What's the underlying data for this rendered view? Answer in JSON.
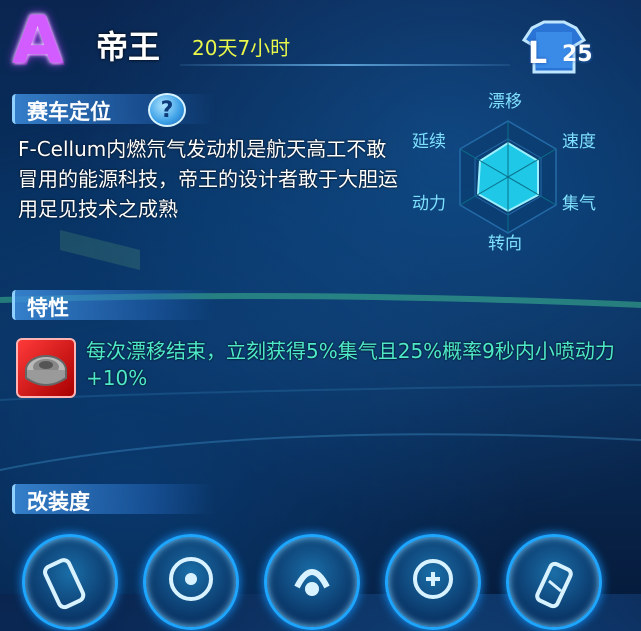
{
  "header": {
    "grade": "A",
    "car_name": "帝王",
    "duration": "20天7小时",
    "level_prefix": "L",
    "level": "25"
  },
  "positioning": {
    "title": "赛车定位",
    "help_label": "?",
    "description": "F-Cellum内燃氘气发动机是航天高工不敢冒用的能源科技，帝王的设计者敢于大胆运用足见技术之成熟"
  },
  "radar": {
    "labels": [
      "漂移",
      "速度",
      "集气",
      "转向",
      "动力",
      "延续"
    ]
  },
  "traits": {
    "title": "特性",
    "text": "每次漂移结束，立刻获得5%集气且25%概率9秒内小喷动力+10%"
  },
  "modification": {
    "title": "改装度",
    "items": [
      "engine-part-icon",
      "wheel-icon",
      "steering-icon",
      "turbo-icon",
      "nitro-bottle-icon"
    ]
  },
  "colors": {
    "grade": "#d25cff",
    "duration": "#e9f64a",
    "trait_text": "#4de9c8",
    "radar_fill": "#1ec8e6"
  }
}
